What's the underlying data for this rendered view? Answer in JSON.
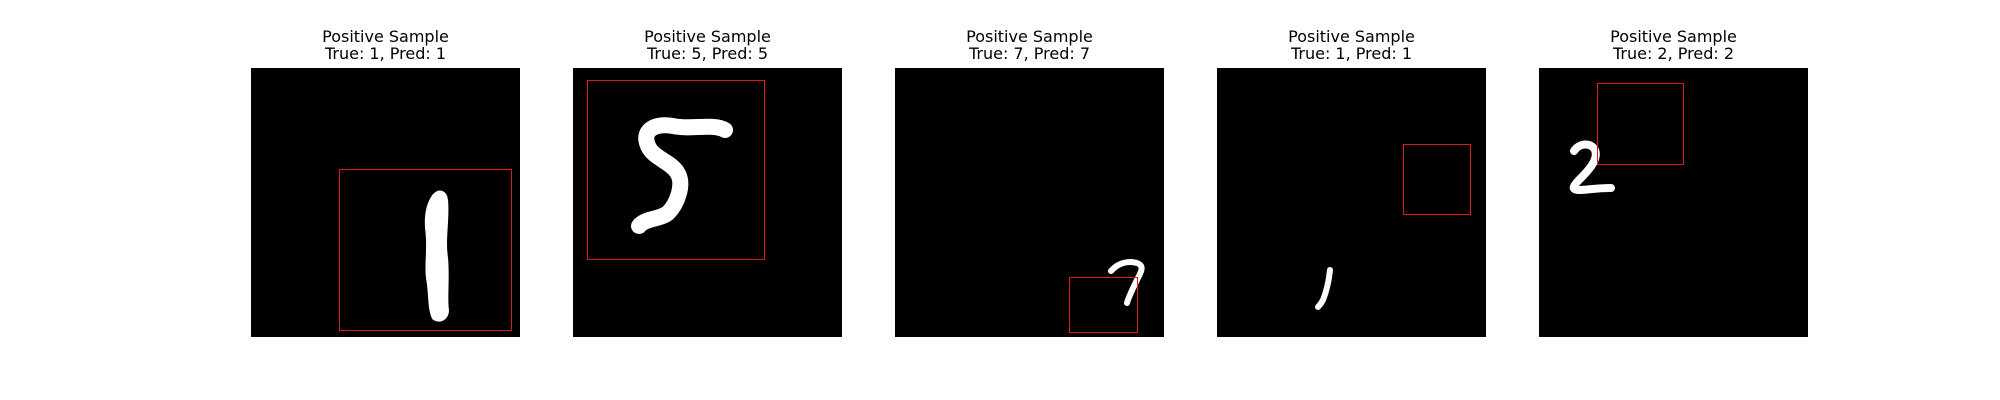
{
  "figure": {
    "panels": [
      {
        "title": "Positive Sample",
        "subtitle": "True: 1, Pred: 1",
        "digit_icon": "digit-1-icon",
        "box_color": "#e31a1c"
      },
      {
        "title": "Positive Sample",
        "subtitle": "True: 5, Pred: 5",
        "digit_icon": "digit-5-icon",
        "box_color": "#e31a1c"
      },
      {
        "title": "Positive Sample",
        "subtitle": "True: 7, Pred: 7",
        "digit_icon": "digit-7-icon",
        "box_color": "#e31a1c"
      },
      {
        "title": "Positive Sample",
        "subtitle": "True: 1, Pred: 1",
        "digit_icon": "digit-1-icon",
        "box_color": "#e31a1c"
      },
      {
        "title": "Positive Sample",
        "subtitle": "True: 2, Pred: 2",
        "digit_icon": "digit-2-icon",
        "box_color": "#e31a1c"
      }
    ],
    "background_color": "#000000",
    "digit_color": "#ffffff"
  }
}
